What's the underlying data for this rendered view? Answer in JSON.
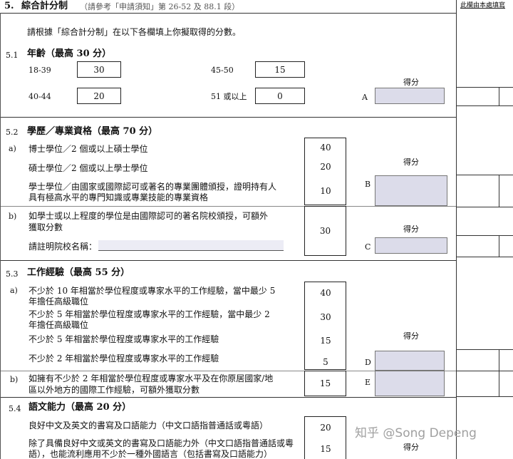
{
  "header": {
    "section": "5.",
    "title": "綜合計分制",
    "note": "（請參考「申請須知」第 26-52 及 88.1 段）",
    "right_note": "此欄由本處填寫"
  },
  "intro": "請根據「綜合計分制」在以下各欄填上你擬取得的分數。",
  "score_label": "得分",
  "s51": {
    "num": "5.1",
    "title": "年齡（最高 30 分）",
    "rows": [
      {
        "label": "18-39",
        "value": "30"
      },
      {
        "label": "40-44",
        "value": "20"
      },
      {
        "label": "45-50",
        "value": "15"
      },
      {
        "label": "51 或以上",
        "value": "0"
      }
    ],
    "letter": "A"
  },
  "s52": {
    "num": "5.2",
    "title": "學歷／專業資格（最高 70 分）",
    "a_tag": "a)",
    "b_tag": "b)",
    "items": [
      {
        "text": "博士學位／2 個或以上碩士學位",
        "points": "40"
      },
      {
        "text": "碩士學位／2 個或以上學士學位",
        "points": "20"
      },
      {
        "text_line1": "學士學位／由國家或國際認可或著名的專業團體頒授，證明持有人",
        "text_line2": "具有極高水平的專門知識或專業技能的專業資格",
        "points": "10"
      }
    ],
    "b_line1": "如學士或以上程度的學位是由國際認可的著名院校頒授，可額外",
    "b_line2": "獲取分數",
    "b_points": "30",
    "school_label": "請註明院校名稱：",
    "letter_b": "B",
    "letter_c": "C"
  },
  "s53": {
    "num": "5.3",
    "title": "工作經驗（最高 55 分）",
    "a_tag": "a)",
    "b_tag": "b)",
    "items": [
      {
        "line1": "不少於 10 年相當於學位程度或專家水平的工作經驗，當中最少 5",
        "line2": "年擔任高級職位",
        "points": "40"
      },
      {
        "line1": "不少於 5 年相當於學位程度或專家水平的工作經驗，當中最少 2",
        "line2": "年擔任高級職位",
        "points": "30"
      },
      {
        "line1": "不少於 5 年相當於學位程度或專家水平的工作經驗",
        "line2": "",
        "points": "15"
      },
      {
        "line1": "不少於 2 年相當於學位程度或專家水平的工作經驗",
        "line2": "",
        "points": "5"
      }
    ],
    "b_line1": "如擁有不少於 2 年相當於學位程度或專家水平及在你原居國家/地",
    "b_line2": "區以外地方的國際工作經驗，可額外獲取分數",
    "b_points": "15",
    "letter_d": "D",
    "letter_e": "E"
  },
  "s54": {
    "num": "5.4",
    "title": "語文能力（最高 20 分）",
    "item1": "良好中文及英文的書寫及口語能力（中文口語指普通話或粵語）",
    "item1_points": "20",
    "item2_line1": "除了具備良好中文或英文的書寫及口語能力外（中文口語指普通話或粵",
    "item2_line2": "語），也能流利應用不少於一種外國語言（包括書寫及口語能力）",
    "item2_points": "15"
  },
  "watermark": "知乎 @Song Depeng"
}
